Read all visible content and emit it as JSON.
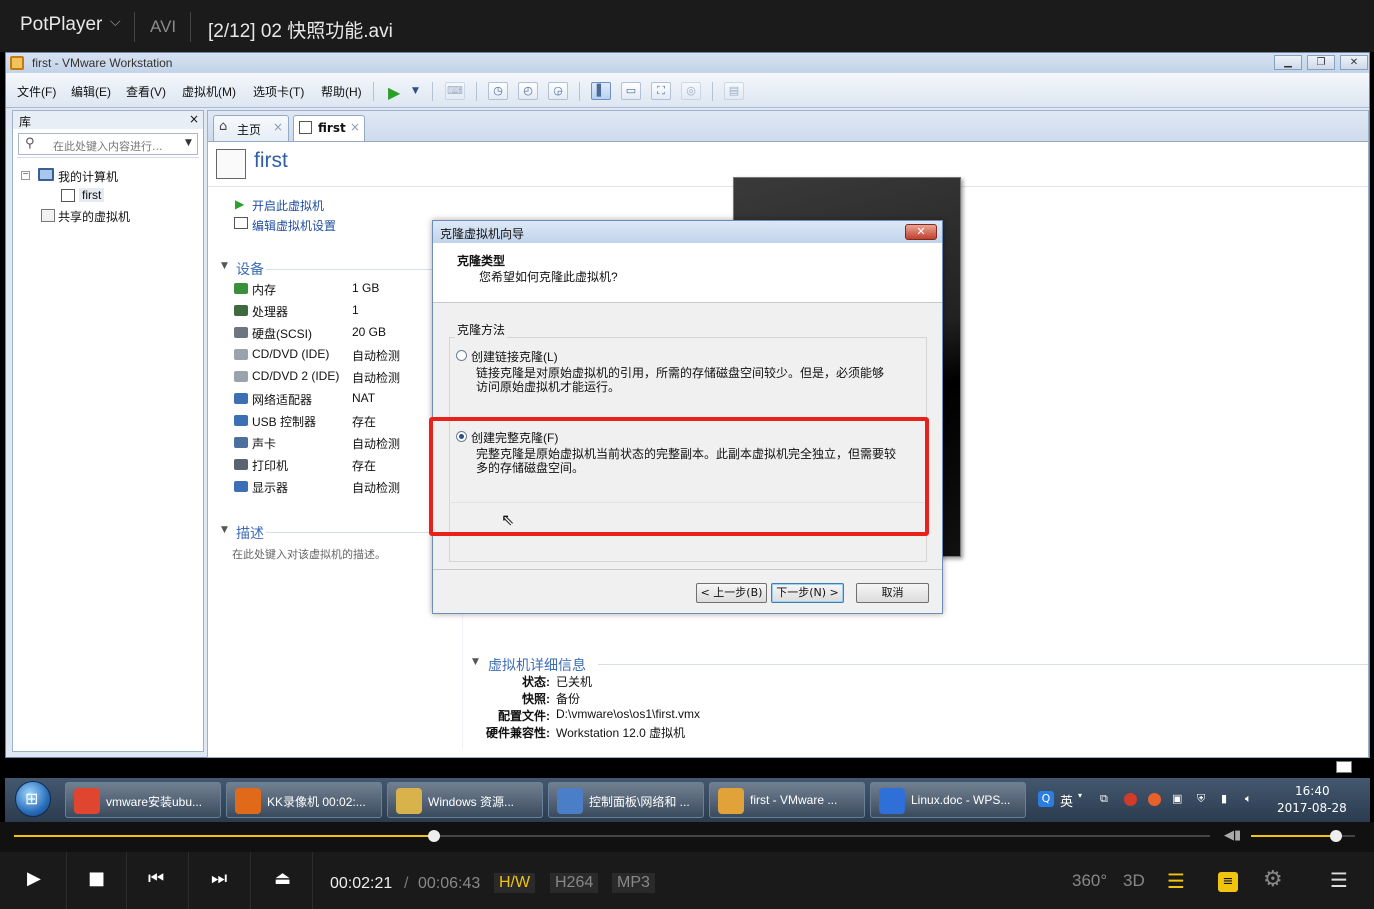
{
  "player": {
    "app_name": "PotPlayer",
    "format": "AVI",
    "file_title": "[2/12] 02 快照功能.avi",
    "time_current": "00:02:21",
    "time_separator": "/",
    "time_total": "00:06:43",
    "hw_label": "H/W",
    "video_codec": "H264",
    "audio_codec": "MP3",
    "btn_360": "360°",
    "btn_3d": "3D",
    "progress_fraction": 0.351,
    "volume_fraction": 0.82,
    "accent_color": "#f1c40f"
  },
  "vmware": {
    "window_title": "first - VMware Workstation",
    "menu": [
      "文件(F)",
      "编辑(E)",
      "查看(V)",
      "虚拟机(M)",
      "选项卡(T)",
      "帮助(H)"
    ],
    "library": {
      "title": "库",
      "close": "×",
      "search_placeholder": "在此处键入内容进行...",
      "tree": {
        "my_computer": "我的计算机",
        "vm_first": "first",
        "shared": "共享的虚拟机"
      }
    },
    "tabs": [
      {
        "label": "主页",
        "close": "×"
      },
      {
        "label": "first",
        "close": "×"
      }
    ],
    "vm_name": "first",
    "actions": {
      "power_on": "开启此虚拟机",
      "edit_settings": "编辑虚拟机设置"
    },
    "devices_title": "设备",
    "devices": [
      {
        "name": "内存",
        "value": "1 GB"
      },
      {
        "name": "处理器",
        "value": "1"
      },
      {
        "name": "硬盘(SCSI)",
        "value": "20 GB"
      },
      {
        "name": "CD/DVD (IDE)",
        "value": "自动检测"
      },
      {
        "name": "CD/DVD 2 (IDE)",
        "value": "自动检测"
      },
      {
        "name": "网络适配器",
        "value": "NAT"
      },
      {
        "name": "USB 控制器",
        "value": "存在"
      },
      {
        "name": "声卡",
        "value": "自动检测"
      },
      {
        "name": "打印机",
        "value": "存在"
      },
      {
        "name": "显示器",
        "value": "自动检测"
      }
    ],
    "description_title": "描述",
    "description_placeholder": "在此处键入对该虚拟机的描述。",
    "details_title": "虚拟机详细信息",
    "details": [
      {
        "key": "状态:",
        "value": "已关机"
      },
      {
        "key": "快照:",
        "value": "备份"
      },
      {
        "key": "配置文件:",
        "value": "D:\\vmware\\os\\os1\\first.vmx"
      },
      {
        "key": "硬件兼容性:",
        "value": "Workstation 12.0 虚拟机"
      }
    ]
  },
  "dialog": {
    "title": "克隆虚拟机向导",
    "close": "✕",
    "heading": "克隆类型",
    "subheading": "您希望如何克隆此虚拟机?",
    "group_label": "克隆方法",
    "option_linked": {
      "label": "创建链接克隆(L)",
      "desc_line1": "链接克隆是对原始虚拟机的引用，所需的存储磁盘空间较少。但是，必须能够",
      "desc_line2": "访问原始虚拟机才能运行。",
      "selected": false
    },
    "option_full": {
      "label": "创建完整克隆(F)",
      "desc_line1": "完整克隆是原始虚拟机当前状态的完整副本。此副本虚拟机完全独立，但需要较",
      "desc_line2": "多的存储磁盘空间。",
      "selected": true
    },
    "buttons": {
      "back": "< 上一步(B)",
      "next": "下一步(N) >",
      "cancel": "取消"
    },
    "highlight_color": "#e8221b"
  },
  "taskbar": {
    "items": [
      {
        "label": "vmware安装ubu...",
        "icon": "chrome-icon"
      },
      {
        "label": "KK录像机 00:02:...",
        "icon": "kk-recorder-icon"
      },
      {
        "label": "Windows 资源...",
        "icon": "folder-icon"
      },
      {
        "label": "控制面板\\网络和 ...",
        "icon": "control-panel-icon"
      },
      {
        "label": "first - VMware ...",
        "icon": "vmware-icon"
      },
      {
        "label": "Linux.doc - WPS...",
        "icon": "wps-icon"
      }
    ],
    "ime": "英",
    "clock_time": "16:40",
    "clock_date": "2017-08-28"
  }
}
